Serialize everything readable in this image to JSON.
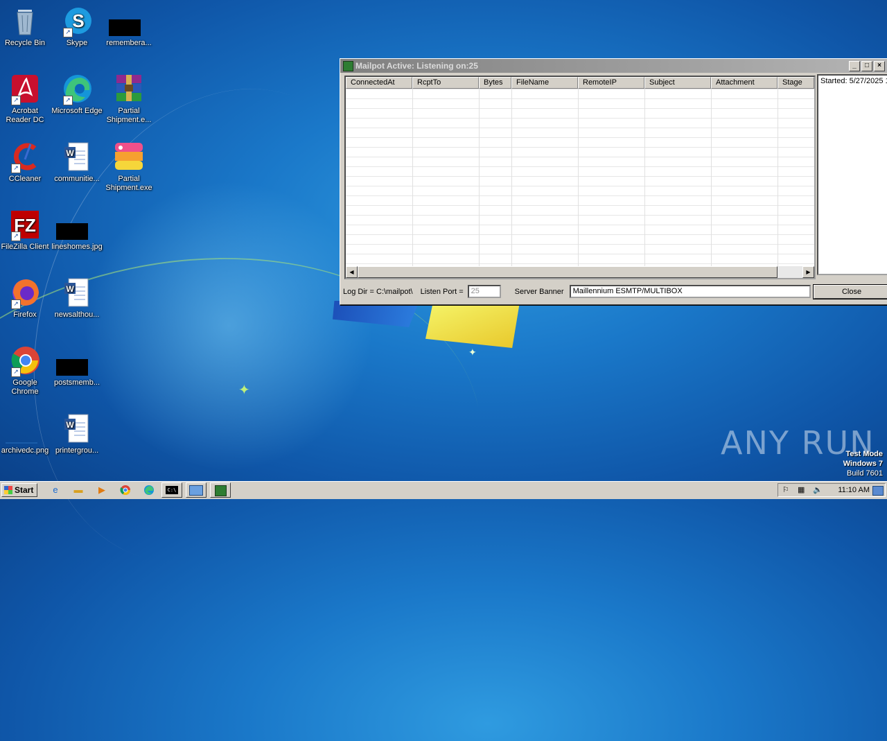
{
  "desktop": {
    "icons": [
      {
        "label": "Recycle Bin"
      },
      {
        "label": "Skype"
      },
      {
        "label": "remembera..."
      },
      {
        "label": "Acrobat Reader DC"
      },
      {
        "label": "Microsoft Edge"
      },
      {
        "label": "Partial Shipment.e..."
      },
      {
        "label": "CCleaner"
      },
      {
        "label": "communitie..."
      },
      {
        "label": "Partial Shipment.exe"
      },
      {
        "label": "FileZilla Client"
      },
      {
        "label": "lineshomes.jpg"
      },
      {
        "label": "Firefox"
      },
      {
        "label": "newsalthou..."
      },
      {
        "label": "Google Chrome"
      },
      {
        "label": "postsmemb..."
      },
      {
        "label": "archivedc.png"
      },
      {
        "label": "printergrou..."
      }
    ]
  },
  "window": {
    "title": "Mailpot Active: Listening on:25",
    "columns": [
      "ConnectedAt",
      "RcptTo",
      "Bytes",
      "FileName",
      "RemoteIP",
      "Subject",
      "Attachment",
      "Stage"
    ],
    "log_text": "Started: 5/27/2025 1",
    "log_dir_label": "Log Dir = C:\\mailpot\\",
    "listen_port_label": "Listen Port =",
    "listen_port_value": "25",
    "server_banner_label": "Server Banner",
    "server_banner_value": "Maillennium ESMTP/MULTIBOX",
    "close_label": "Close"
  },
  "watermark": {
    "text": "ANY RUN",
    "test_mode": "Test Mode",
    "os": "Windows 7",
    "build": "Build 7601"
  },
  "taskbar": {
    "start_label": "Start",
    "clock": "11:10 AM"
  }
}
